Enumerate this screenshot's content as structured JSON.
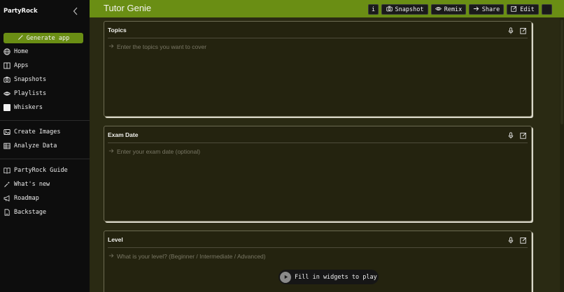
{
  "sidebar": {
    "brand": "PartyRock",
    "collapse_icon": "chevron-left-icon",
    "generate_label": "Generate app",
    "primary": [
      {
        "label": "Home",
        "icon": "globe-icon"
      },
      {
        "label": "Apps",
        "icon": "book-icon"
      },
      {
        "label": "Snapshots",
        "icon": "camera-icon"
      },
      {
        "label": "Playlists",
        "icon": "eye-icon"
      },
      {
        "label": "Whiskers",
        "icon": "square-icon"
      }
    ],
    "tools": [
      {
        "label": "Create Images",
        "icon": "images-icon"
      },
      {
        "label": "Analyze Data",
        "icon": "table-icon"
      }
    ],
    "resources": [
      {
        "label": "PartyRock Guide",
        "icon": "open-book-icon"
      },
      {
        "label": "What's new",
        "icon": "sparkle-icon"
      },
      {
        "label": "Roadmap",
        "icon": "megaphone-icon"
      },
      {
        "label": "Backstage",
        "icon": "file-icon"
      }
    ]
  },
  "header": {
    "title": "Tutor Genie",
    "buttons": {
      "info": "i",
      "snapshot": "Snapshot",
      "remix": "Remix",
      "share": "Share",
      "edit": "Edit"
    }
  },
  "widgets": [
    {
      "title": "Topics",
      "placeholder": "Enter the topics you want to cover"
    },
    {
      "title": "Exam Date",
      "placeholder": "Enter your exam date (optional)"
    },
    {
      "title": "Level",
      "placeholder": "What is your level? (Beginner / Intermediate / Advanced)"
    }
  ],
  "play": {
    "label": "Fill in widgets to play"
  },
  "colors": {
    "accent": "#6a8e14",
    "canvas": "#2a2a13",
    "sidebar": "#0d0d0d",
    "card": "#24230f"
  }
}
